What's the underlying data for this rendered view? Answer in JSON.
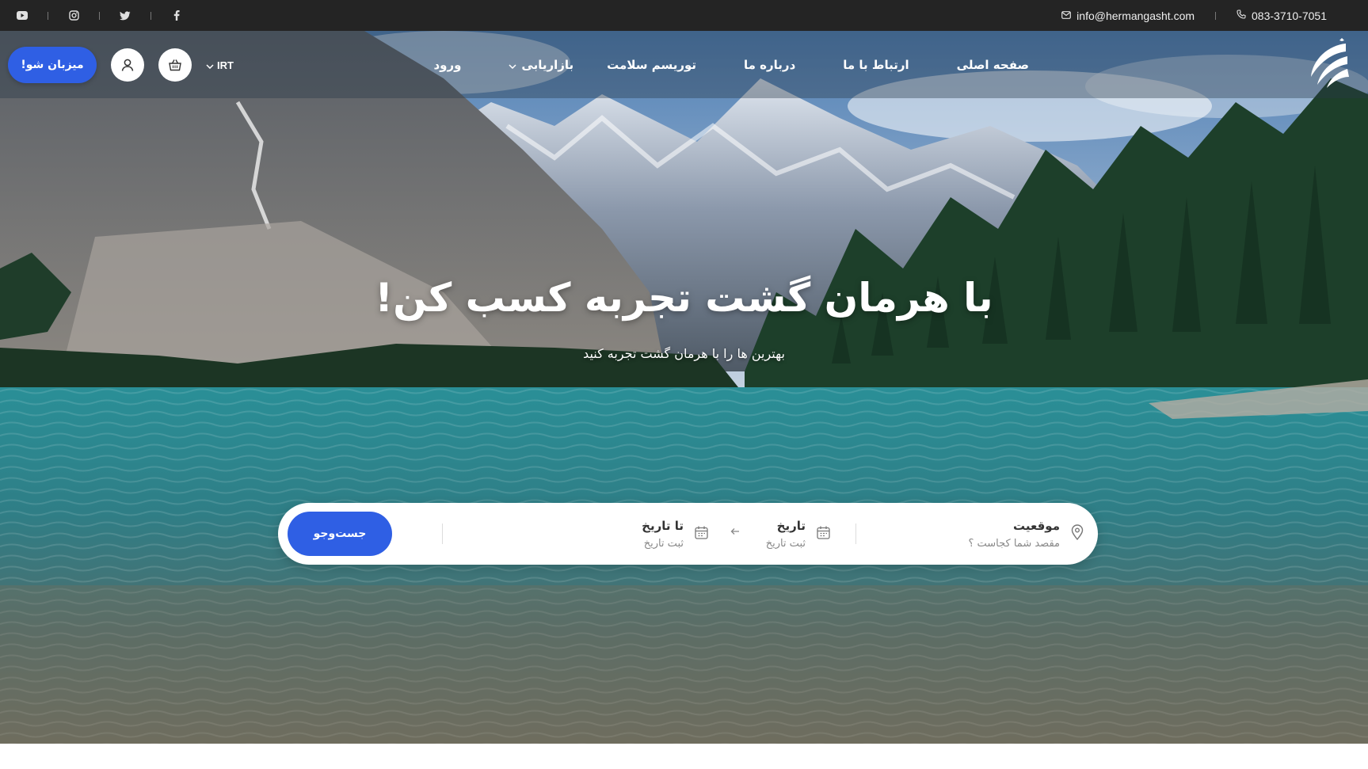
{
  "topbar": {
    "social_icons": [
      "youtube-icon",
      "instagram-icon",
      "twitter-icon",
      "facebook-icon"
    ],
    "email": "info@hermangasht.com",
    "phone": "083-3710-7051"
  },
  "nav": {
    "links": {
      "home": "صفحه اصلی",
      "contact": "ارتباط با ما",
      "about": "درباره ما",
      "health_tourism": "توریسم سلامت",
      "marketing": "بازاریابی",
      "login": "ورود"
    },
    "currency": "IRT",
    "host_button": "میزبان شو!"
  },
  "hero": {
    "title": "با هرمان گشت تجربه کسب کن!",
    "subtitle": "بهترین ها را با هرمان گشت تجربه کنید"
  },
  "search": {
    "location_label": "موقعیت",
    "location_placeholder": "مقصد شما کجاست ؟",
    "date_from_label": "تاریخ",
    "date_from_placeholder": "ثبت تاریخ",
    "date_to_label": "تا تاریخ",
    "date_to_placeholder": "ثبت تاریخ",
    "submit_label": "جست‌وجو"
  },
  "colors": {
    "accent": "#2f5fe4",
    "topbar": "#242424"
  }
}
